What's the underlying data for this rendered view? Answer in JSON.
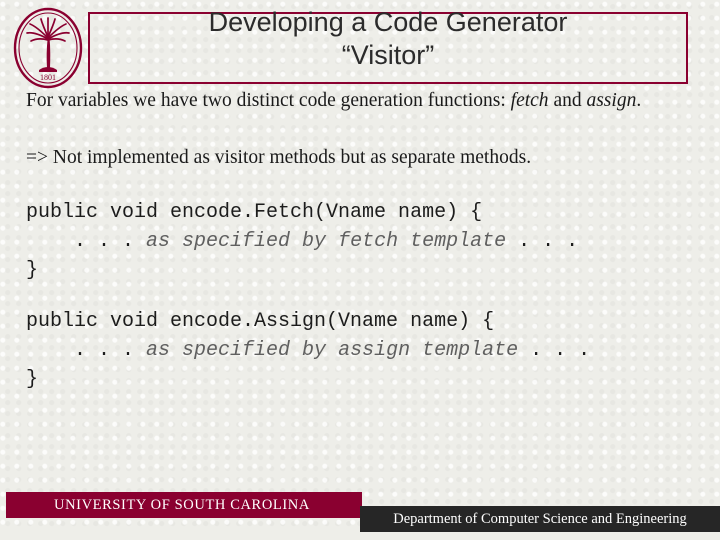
{
  "slide": {
    "title_line1": "Developing a Code Generator",
    "title_line2": "“Visitor”",
    "paragraph1_part1": "For variables we have two distinct code generation functions: ",
    "paragraph1_italic1": "fetch",
    "paragraph1_part2": " and ",
    "paragraph1_italic2": "assign",
    "paragraph1_part3": ".",
    "paragraph2": "=> Not implemented as visitor methods but as separate methods.",
    "code_block_1_line1": "public void encode.Fetch(Vname name) {",
    "code_block_1_line2_indent": "    . . . ",
    "code_block_1_line2_comment": "as specified by fetch template",
    "code_block_1_line2_tail": " . . .",
    "code_block_1_line3": "}",
    "code_block_2_line1": "public void encode.Assign(Vname name) {",
    "code_block_2_line2_indent": "    . . . ",
    "code_block_2_line2_comment": "as specified by assign template",
    "code_block_2_line2_tail": " . . .",
    "code_block_2_line3": "}"
  },
  "footer": {
    "left_text": "UNIVERSITY OF SOUTH CAROLINA",
    "right_text": "Department of Computer Science and Engineering"
  },
  "logo": {
    "name": "usc-seal-logo",
    "year": "1801"
  },
  "colors": {
    "accent_maroon": "#8a0030",
    "footer_dark": "#262626",
    "background": "#eeeee9",
    "code_comment": "#5f5f5f"
  }
}
